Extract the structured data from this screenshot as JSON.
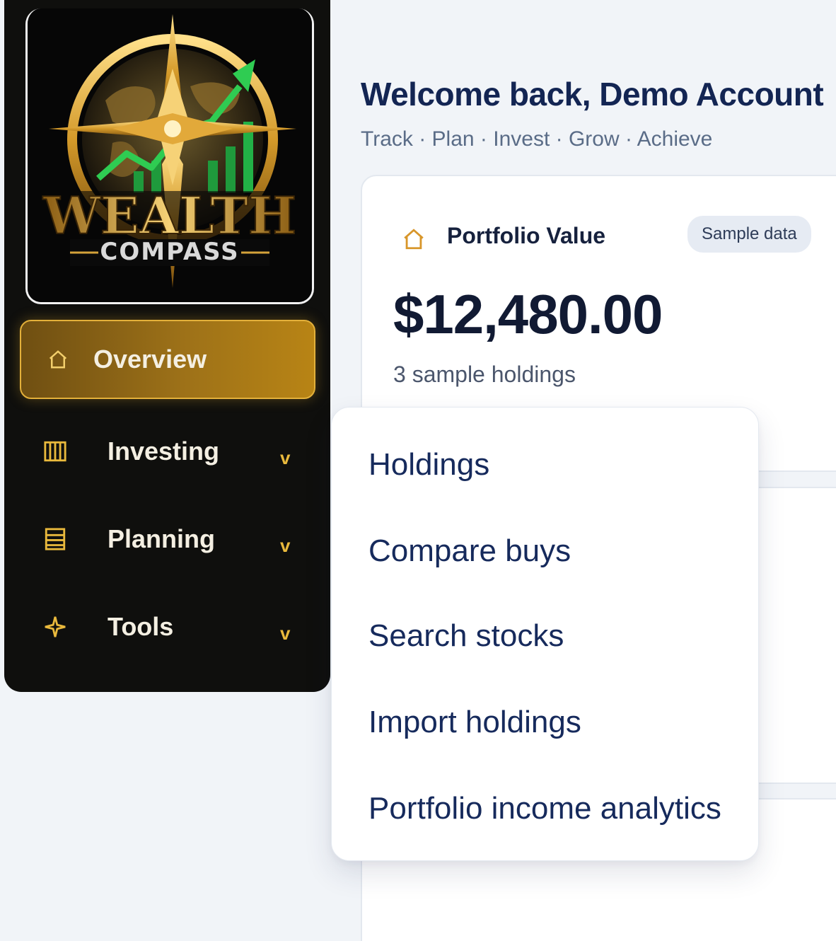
{
  "sidebar": {
    "logo": {
      "line1": "WEALTH",
      "line2": "COMPASS"
    },
    "items": [
      {
        "label": "Overview",
        "icon": "home-icon",
        "active": true
      },
      {
        "label": "Investing",
        "icon": "columns-icon",
        "chevron": "v"
      },
      {
        "label": "Planning",
        "icon": "list-icon",
        "chevron": "v"
      },
      {
        "label": "Tools",
        "icon": "sparkle-icon",
        "chevron": "v"
      }
    ]
  },
  "header": {
    "title": "Welcome back, Demo Account",
    "tagline": "Track · Plan · Invest · Grow · Achieve"
  },
  "portfolio": {
    "title": "Portfolio Value",
    "badge": "Sample data",
    "value": "$12,480.00",
    "subtitle": "3 sample holdings",
    "icon": "home-icon"
  },
  "dropdown": {
    "items": [
      "Holdings",
      "Compare buys",
      "Search stocks",
      "Import holdings",
      "Portfolio income analytics"
    ]
  },
  "colors": {
    "sidebar_bg": "#0f0f0d",
    "gold_accent": "#e9b93c",
    "heading_navy": "#132553",
    "page_bg": "#f1f4f8"
  }
}
